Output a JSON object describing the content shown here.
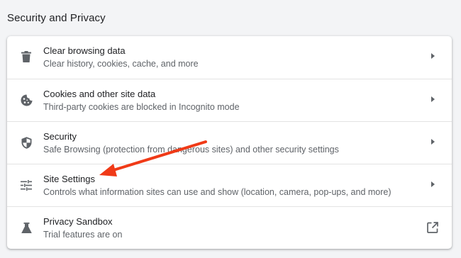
{
  "section": {
    "title": "Security and Privacy"
  },
  "rows": [
    {
      "icon": "trash-icon",
      "label": "Clear browsing data",
      "sublabel": "Clear history, cookies, cache, and more",
      "action": "chevron-right-icon"
    },
    {
      "icon": "cookie-icon",
      "label": "Cookies and other site data",
      "sublabel": "Third-party cookies are blocked in Incognito mode",
      "action": "chevron-right-icon"
    },
    {
      "icon": "shield-icon",
      "label": "Security",
      "sublabel": "Safe Browsing (protection from dangerous sites) and other security settings",
      "action": "chevron-right-icon"
    },
    {
      "icon": "tune-sliders-icon",
      "label": "Site Settings",
      "sublabel": "Controls what information sites can use and show (location, camera, pop-ups, and more)",
      "action": "chevron-right-icon"
    },
    {
      "icon": "flask-icon",
      "label": "Privacy Sandbox",
      "sublabel": "Trial features are on",
      "action": "open-in-new-icon"
    }
  ],
  "annotation": {
    "type": "arrow",
    "color": "#f03a17",
    "points_to": "Site Settings"
  }
}
